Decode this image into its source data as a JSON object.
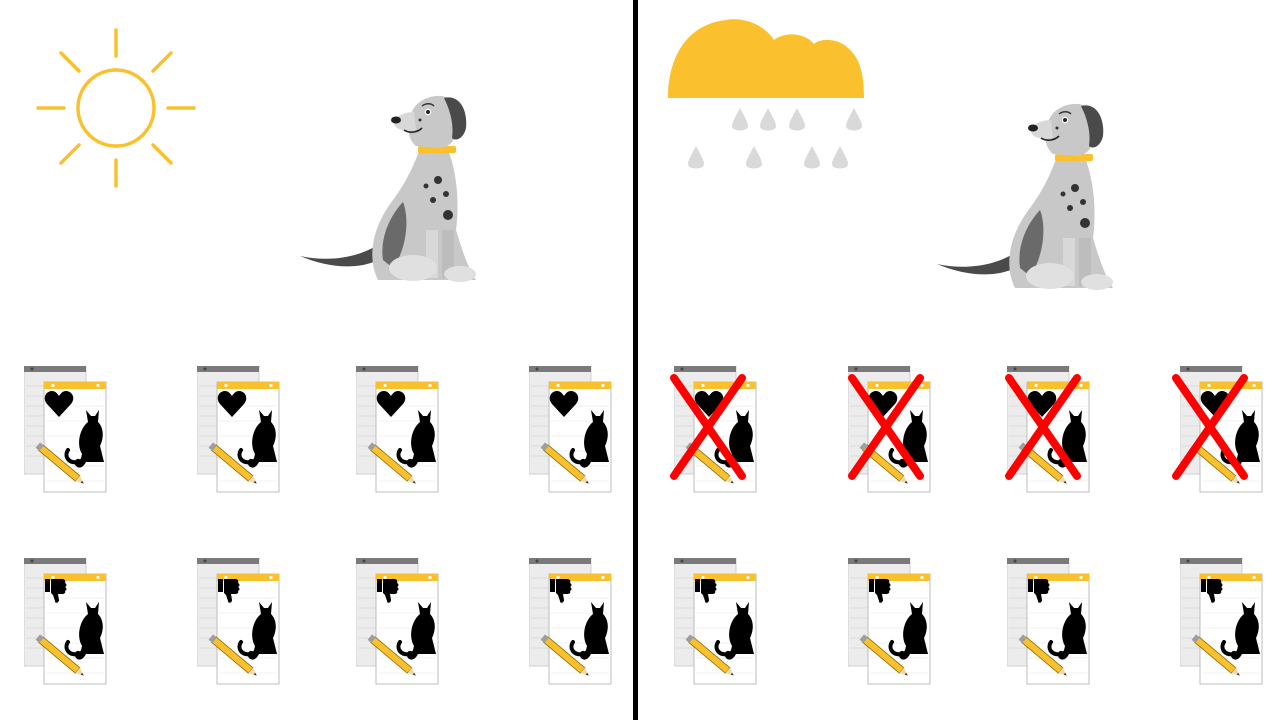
{
  "colors": {
    "accent_yellow": "#fbc02d",
    "divider": "#000000",
    "cross_red": "#ff0000",
    "raindrop": "#d9d9d9",
    "dog_body": "#c8c8c8",
    "dog_dark": "#4a4a4a",
    "notepad_back": "#ececec",
    "notepad_front": "#ffffff"
  },
  "left_scene": {
    "weather": "sun-icon",
    "subject": "dog-icon",
    "row_top": [
      {
        "icon": "heart-icon",
        "crossed": false
      },
      {
        "icon": "heart-icon",
        "crossed": false
      },
      {
        "icon": "heart-icon",
        "crossed": false
      },
      {
        "icon": "heart-icon",
        "crossed": false
      }
    ],
    "row_bottom": [
      {
        "icon": "thumbs-down-icon",
        "crossed": false
      },
      {
        "icon": "thumbs-down-icon",
        "crossed": false
      },
      {
        "icon": "thumbs-down-icon",
        "crossed": false
      },
      {
        "icon": "thumbs-down-icon",
        "crossed": false
      }
    ]
  },
  "right_scene": {
    "weather": "rain-cloud-icon",
    "subject": "dog-icon",
    "row_top": [
      {
        "icon": "heart-icon",
        "crossed": true
      },
      {
        "icon": "heart-icon",
        "crossed": true
      },
      {
        "icon": "heart-icon",
        "crossed": true
      },
      {
        "icon": "heart-icon",
        "crossed": true
      }
    ],
    "row_bottom": [
      {
        "icon": "thumbs-down-icon",
        "crossed": false
      },
      {
        "icon": "thumbs-down-icon",
        "crossed": false
      },
      {
        "icon": "thumbs-down-icon",
        "crossed": false
      },
      {
        "icon": "thumbs-down-icon",
        "crossed": false
      }
    ]
  }
}
